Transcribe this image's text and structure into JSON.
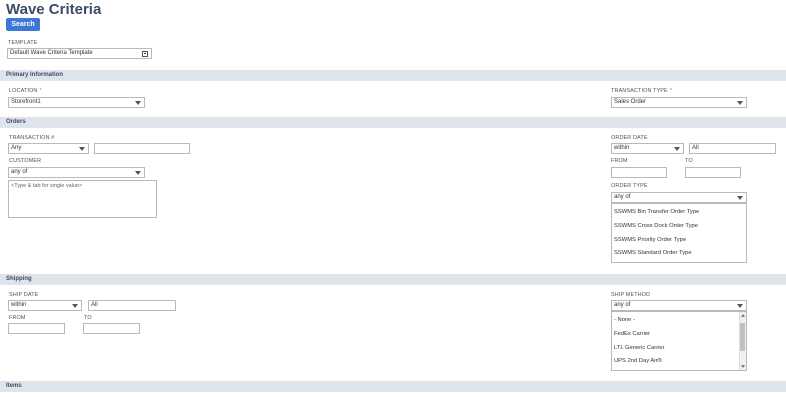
{
  "page": {
    "title": "Wave Criteria",
    "search_label": "Search"
  },
  "template": {
    "label": "TEMPLATE",
    "value": "Default Wave Criteria Template"
  },
  "primary": {
    "title": "Primary Information",
    "location_label": "LOCATION",
    "location_value": "Storefront1",
    "transaction_type_label": "TRANSACTION TYPE",
    "transaction_type_value": "Sales Order",
    "required_mark": "*"
  },
  "orders": {
    "title": "Orders",
    "transaction_label": "TRANSACTION #",
    "transaction_op": "Any",
    "transaction_value": "",
    "customer_label": "CUSTOMER",
    "customer_op": "any of",
    "customer_placeholder": "<Type & tab for single value>",
    "order_date_label": "ORDER DATE",
    "order_date_op": "within",
    "order_date_value": "All",
    "from_label": "FROM",
    "to_label": "TO",
    "order_type_label": "ORDER TYPE",
    "order_type_op": "any of",
    "order_types": [
      "SSWMS Bin Transfer Order Type",
      "SSWMS Cross Dock Order Type",
      "SSWMS Priority Order Type",
      "SSWMS Standard Order Type"
    ]
  },
  "shipping": {
    "title": "Shipping",
    "ship_date_label": "SHIP DATE",
    "ship_date_op": "within",
    "ship_date_value": "All",
    "from_label": "FROM",
    "to_label": "TO",
    "ship_method_label": "SHIP METHOD",
    "ship_method_op": "any of",
    "ship_methods": [
      "- None -",
      "FedEx Carrier",
      "LTL Generic Carrier",
      "UPS 2nd Day Air®"
    ]
  },
  "items": {
    "title": "Items"
  }
}
